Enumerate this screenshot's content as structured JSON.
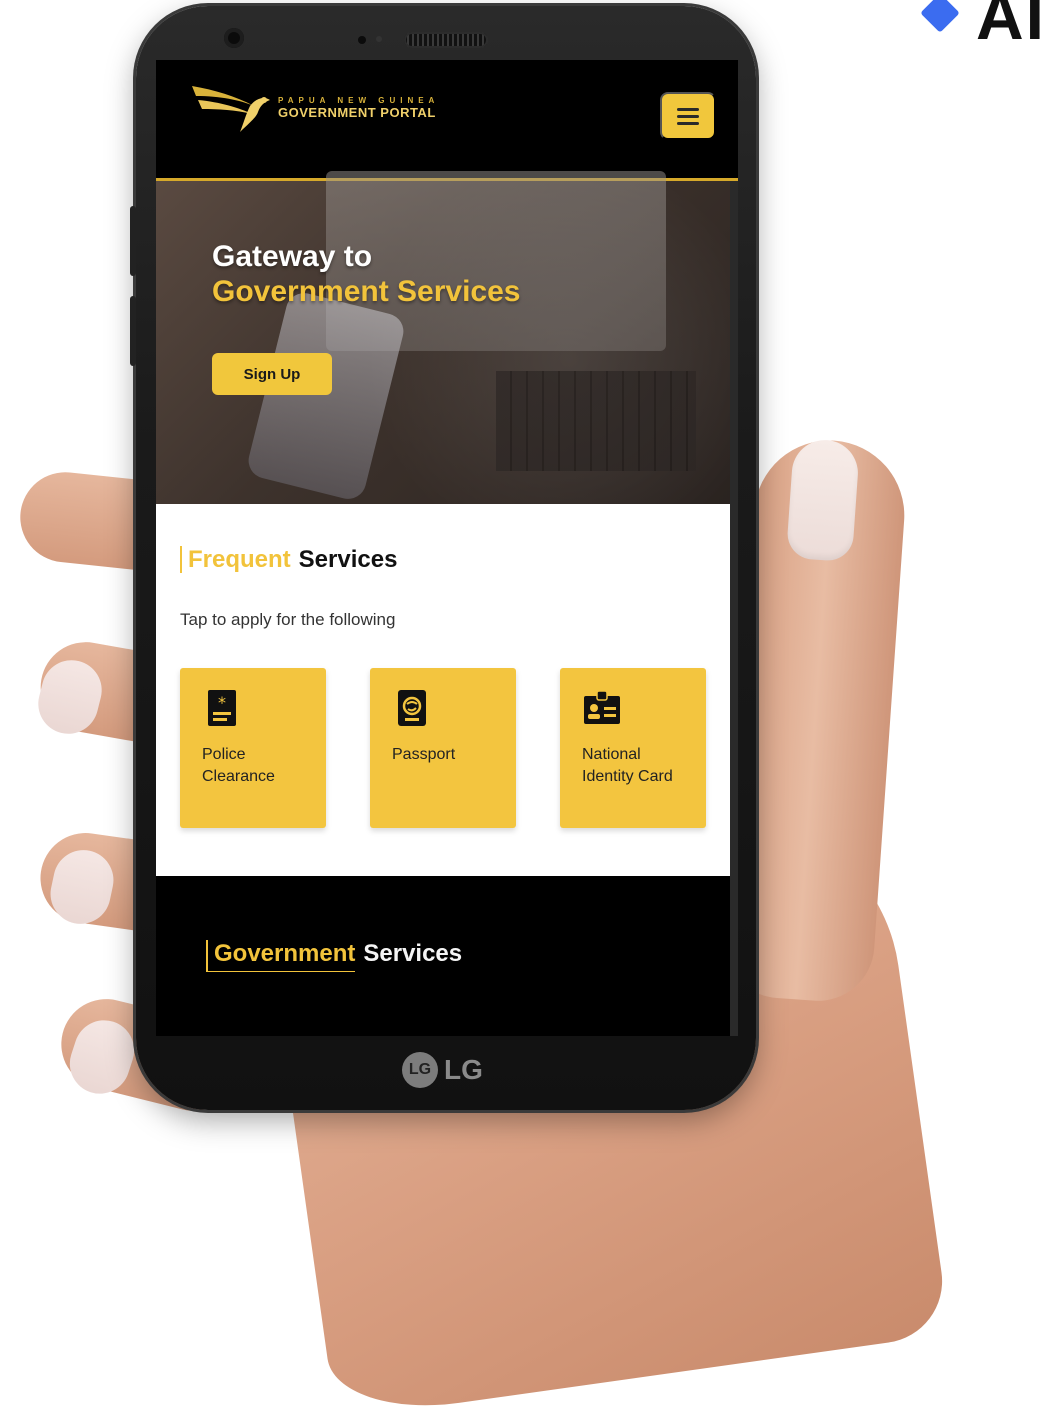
{
  "corner_logo": {
    "text": "AI"
  },
  "device": {
    "brand": "LG",
    "brand_symbol": "LG"
  },
  "header": {
    "logo_small": "PAPUA NEW GUINEA",
    "logo_big": "GOVERNMENT PORTAL",
    "menu_icon": "hamburger-icon"
  },
  "hero": {
    "title_line1": "Gateway to",
    "title_line2": "Government Services",
    "signup_label": "Sign Up"
  },
  "frequent": {
    "title_accent": "Frequent",
    "title_rest": "Services",
    "subtitle": "Tap to apply for the following",
    "cards": [
      {
        "label": "Police Clearance",
        "icon": "police-clearance-icon"
      },
      {
        "label": "Passport",
        "icon": "passport-icon"
      },
      {
        "label": "National Identity Card",
        "icon": "id-card-icon"
      }
    ]
  },
  "government": {
    "title_accent": "Government",
    "title_rest": "Services"
  },
  "colors": {
    "accent": "#f2c33b",
    "card": "#f3c53f",
    "dark": "#000000"
  }
}
